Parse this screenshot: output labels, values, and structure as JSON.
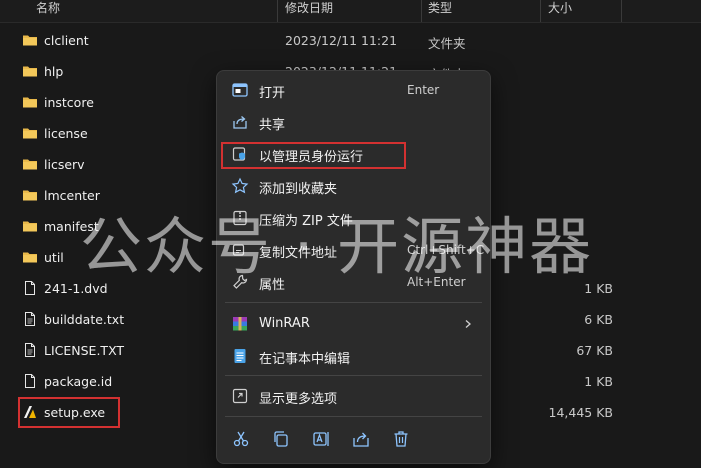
{
  "header": {
    "name": "名称",
    "date": "修改日期",
    "type": "类型",
    "size": "大小"
  },
  "files": [
    {
      "name": "clclient",
      "date": "2023/12/11 11:21",
      "type": "文件夹",
      "size": "",
      "icon": "folder-icon"
    },
    {
      "name": "hlp",
      "date": "2023/12/11 11:21",
      "type": "文件夹",
      "size": "",
      "icon": "folder-icon"
    },
    {
      "name": "instcore",
      "date": "",
      "type": "",
      "size": "",
      "icon": "folder-icon"
    },
    {
      "name": "license",
      "date": "",
      "type": "",
      "size": "",
      "icon": "folder-icon"
    },
    {
      "name": "licserv",
      "date": "",
      "type": "",
      "size": "",
      "icon": "folder-icon"
    },
    {
      "name": "lmcenter",
      "date": "",
      "type": "",
      "size": "",
      "icon": "folder-icon"
    },
    {
      "name": "manifest",
      "date": "",
      "type": "",
      "size": "",
      "icon": "folder-icon"
    },
    {
      "name": "util",
      "date": "",
      "type": "",
      "size": "",
      "icon": "folder-icon"
    },
    {
      "name": "241-1.dvd",
      "date": "",
      "type": "",
      "size": "1 KB",
      "icon": "file-icon"
    },
    {
      "name": "builddate.txt",
      "date": "",
      "type": "",
      "size": "6 KB",
      "icon": "file-icon"
    },
    {
      "name": "LICENSE.TXT",
      "date": "",
      "type": "",
      "size": "67 KB",
      "icon": "file-icon"
    },
    {
      "name": "package.id",
      "date": "",
      "type": "",
      "size": "1 KB",
      "icon": "file-icon"
    },
    {
      "name": "setup.exe",
      "date": "",
      "type": "",
      "size": "14,445 KB",
      "icon": "autodesk-setup-icon"
    }
  ],
  "context_menu": {
    "items": [
      {
        "label": "打开",
        "shortcut": "Enter",
        "icon": "open-icon"
      },
      {
        "label": "共享",
        "shortcut": "",
        "icon": "share-icon"
      },
      {
        "label": "以管理员身份运行",
        "shortcut": "",
        "icon": "admin-shield-icon"
      },
      {
        "label": "添加到收藏夹",
        "shortcut": "",
        "icon": "star-icon"
      },
      {
        "label": "压缩为 ZIP 文件",
        "shortcut": "",
        "icon": "zip-icon"
      },
      {
        "label": "复制文件地址",
        "shortcut": "Ctrl+Shift+C",
        "icon": "copy-path-icon"
      },
      {
        "label": "属性",
        "shortcut": "Alt+Enter",
        "icon": "wrench-icon"
      },
      {
        "label": "WinRAR",
        "shortcut": "",
        "icon": "winrar-icon"
      },
      {
        "label": "在记事本中编辑",
        "shortcut": "",
        "icon": "notepad-icon"
      },
      {
        "label": "显示更多选项",
        "shortcut": "",
        "icon": "more-options-icon"
      }
    ],
    "bottom_icons": [
      "cut-icon",
      "copy-icon",
      "rename-icon",
      "share-icon",
      "delete-icon"
    ]
  },
  "watermark": "公众号 · 开源神器",
  "colors": {
    "background": "#191919",
    "menu_bg": "#2b2b2b",
    "highlight_box": "#d33131",
    "folder": "#e8b84a",
    "accent": "#4aa3e8"
  }
}
